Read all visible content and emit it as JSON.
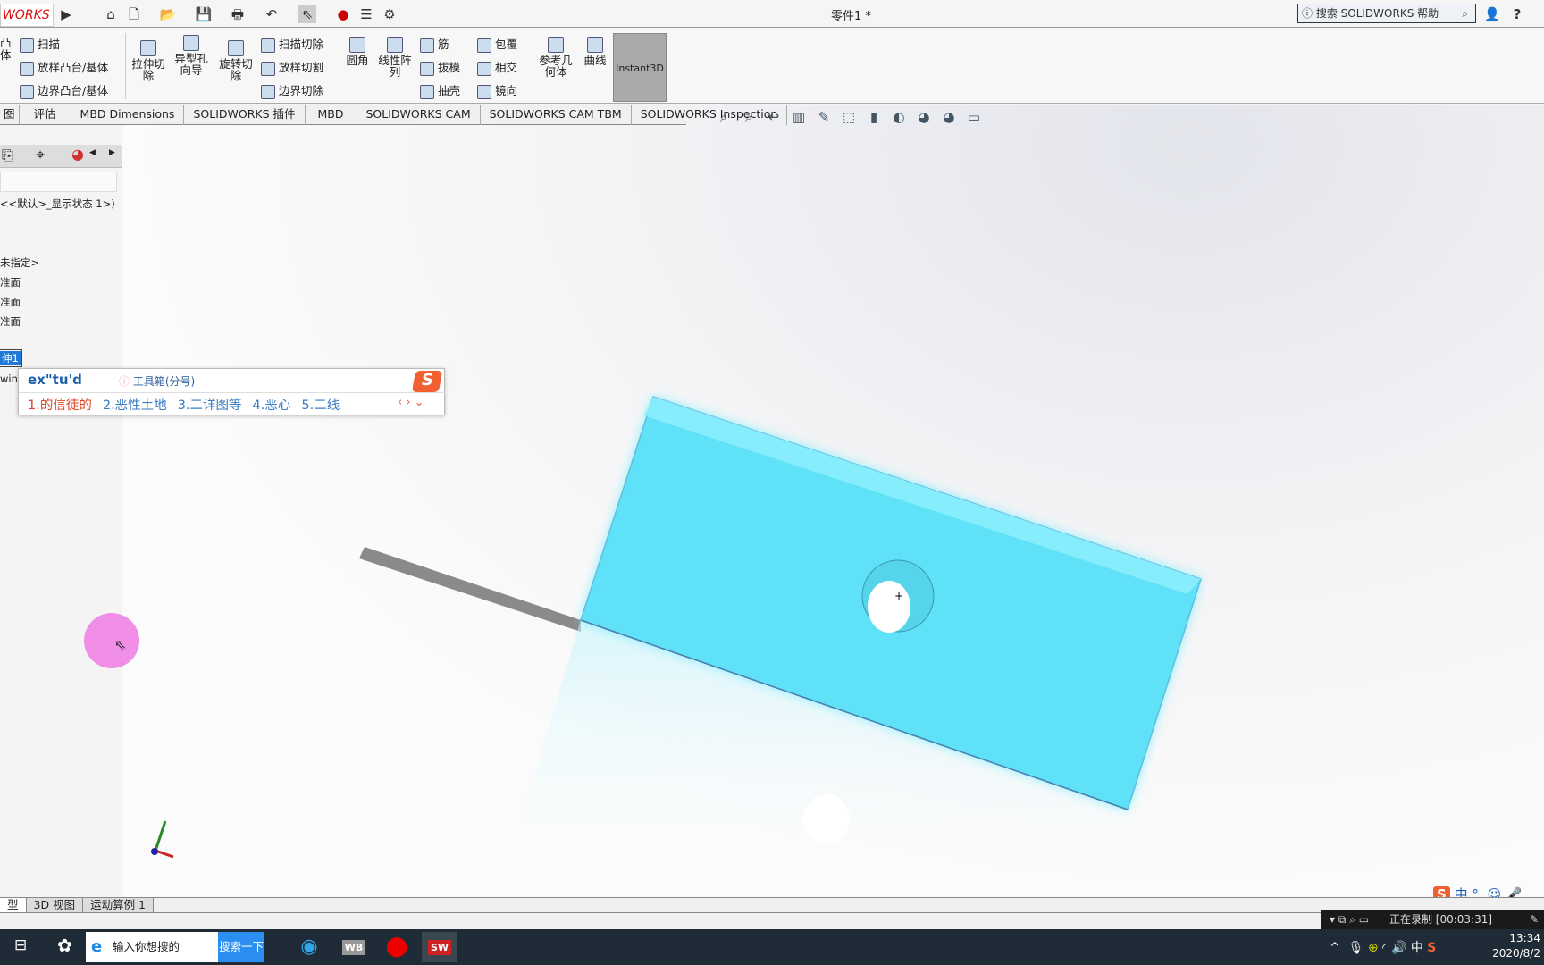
{
  "app": {
    "logo": "WORKS",
    "title": "零件1 *",
    "search_placeholder": "搜索 SOLIDWORKS 帮助"
  },
  "quick_icons": [
    "home-icon",
    "new-document-icon",
    "open-icon",
    "save-icon",
    "print-icon",
    "undo-icon",
    "select-icon",
    "traffic-light-icon",
    "options-list-icon",
    "gear-icon"
  ],
  "ribbon": {
    "col1": [
      "扫描",
      "放样凸台/基体",
      "边界凸台/基体"
    ],
    "col1_partial": "凸\n体",
    "big": [
      {
        "label": "拉伸切除"
      },
      {
        "label": "异型孔向导"
      },
      {
        "label": "旋转切除"
      }
    ],
    "col2": [
      "扫描切除",
      "放样切割",
      "边界切除"
    ],
    "big2": [
      {
        "label": "圆角"
      },
      {
        "label": "线性阵列"
      }
    ],
    "col3": [
      "筋",
      "拔模",
      "抽壳"
    ],
    "col4": [
      "包覆",
      "相交",
      "镜向"
    ],
    "big3": [
      {
        "label": "参考几何体"
      },
      {
        "label": "曲线"
      }
    ],
    "instant3d": "Instant3D"
  },
  "tabs": [
    "图",
    "评估",
    "MBD Dimensions",
    "SOLIDWORKS 插件",
    "MBD",
    "SOLIDWORKS CAM",
    "SOLIDWORKS CAM TBM",
    "SOLIDWORKS Inspection"
  ],
  "tree": {
    "display_state": "<<默认>_显示状态 1>)",
    "items": [
      "未指定>",
      "准面",
      "准面",
      "准面"
    ],
    "selected": "伸1",
    "partial": "win"
  },
  "ime": {
    "composition": "ex\"tu'd",
    "toolbox": "工具箱(分号)",
    "candidates": [
      "1.的信徒的",
      "2.恶性土地",
      "3.二详图等",
      "4.恶心",
      "5.二线"
    ]
  },
  "bottom_tabs": [
    "型",
    "3D 视图",
    "运动算例 1"
  ],
  "taskbar": {
    "search_placeholder": "输入你想搜的",
    "search_button": "搜索一下",
    "apps": [
      "Edge",
      "WB",
      "Recorder",
      "SW 2019"
    ]
  },
  "recorder": {
    "label": "正在录制 [00:03:31]"
  },
  "tray": {
    "ime": "中",
    "time": "13:34",
    "date": "2020/8/2"
  },
  "ime_bar": {
    "lang": "中",
    "punct": "°,"
  },
  "colors": {
    "part": "#5fe0f5",
    "accent": "#2b8ef0"
  }
}
